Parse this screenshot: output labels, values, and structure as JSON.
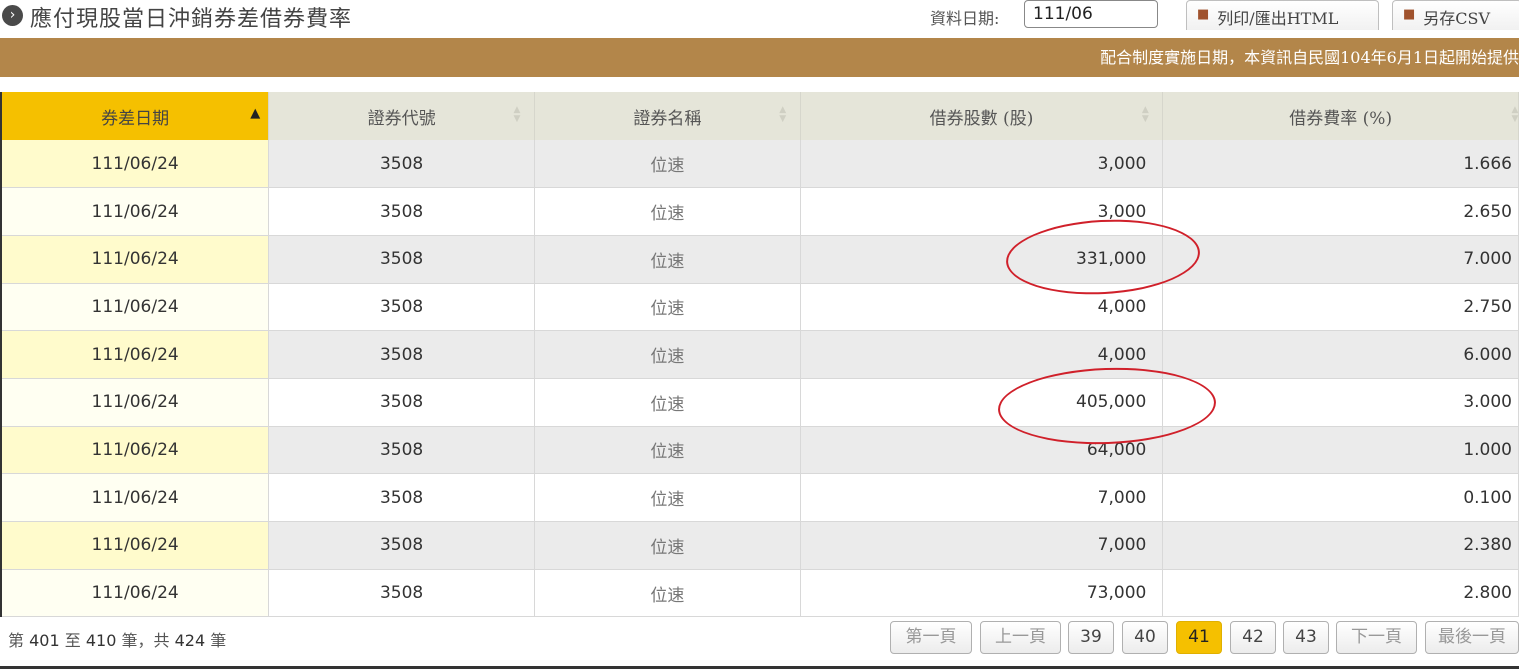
{
  "header": {
    "title": "應付現股當日沖銷券差借券費率",
    "title_icon": "circle-arrow-right-icon",
    "date_label": "資料日期:",
    "date_value": "111/06",
    "print_button": "列印/匯出HTML",
    "csv_button": "另存CSV"
  },
  "notice": "配合制度實施日期，本資訊自民國104年6月1日起開始提供",
  "table": {
    "columns": [
      "券差日期",
      "證券代號",
      "證券名稱",
      "借券股數 (股)",
      "借券費率 (%)"
    ],
    "rows": [
      {
        "date": "111/06/24",
        "code": "3508",
        "name": "位速",
        "qty": "3,000",
        "rate": "1.666"
      },
      {
        "date": "111/06/24",
        "code": "3508",
        "name": "位速",
        "qty": "3,000",
        "rate": "2.650"
      },
      {
        "date": "111/06/24",
        "code": "3508",
        "name": "位速",
        "qty": "331,000",
        "rate": "7.000"
      },
      {
        "date": "111/06/24",
        "code": "3508",
        "name": "位速",
        "qty": "4,000",
        "rate": "2.750"
      },
      {
        "date": "111/06/24",
        "code": "3508",
        "name": "位速",
        "qty": "4,000",
        "rate": "6.000"
      },
      {
        "date": "111/06/24",
        "code": "3508",
        "name": "位速",
        "qty": "405,000",
        "rate": "3.000"
      },
      {
        "date": "111/06/24",
        "code": "3508",
        "name": "位速",
        "qty": "64,000",
        "rate": "1.000"
      },
      {
        "date": "111/06/24",
        "code": "3508",
        "name": "位速",
        "qty": "7,000",
        "rate": "0.100"
      },
      {
        "date": "111/06/24",
        "code": "3508",
        "name": "位速",
        "qty": "7,000",
        "rate": "2.380"
      },
      {
        "date": "111/06/24",
        "code": "3508",
        "name": "位速",
        "qty": "73,000",
        "rate": "2.800"
      }
    ]
  },
  "footer": {
    "summary_prefix": "第",
    "from": "401",
    "mid1": "至",
    "to": "410",
    "mid2": "筆，共",
    "total": "424",
    "suffix": "筆"
  },
  "pager": {
    "first": "第一頁",
    "prev": "上一頁",
    "pages": [
      "39",
      "40",
      "41",
      "42",
      "43"
    ],
    "current": "41",
    "next": "下一頁",
    "last": "最後一頁"
  },
  "colors": {
    "notice_bar": "#b3864a",
    "active_header": "#f5c000",
    "annotation_circle": "#d0202a"
  }
}
